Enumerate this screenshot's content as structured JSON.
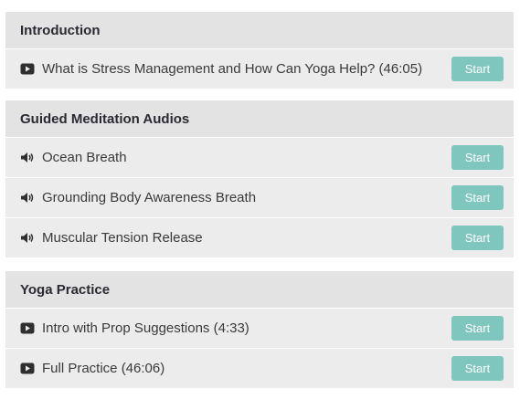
{
  "sections": [
    {
      "title": "Introduction",
      "lessons": [
        {
          "icon": "video-icon",
          "title": "What is Stress Management and How Can Yoga Help? (46:05)",
          "button": "Start"
        }
      ]
    },
    {
      "title": "Guided Meditation Audios",
      "lessons": [
        {
          "icon": "audio-icon",
          "title": "Ocean Breath",
          "button": "Start"
        },
        {
          "icon": "audio-icon",
          "title": "Grounding Body Awareness Breath",
          "button": "Start"
        },
        {
          "icon": "audio-icon",
          "title": "Muscular Tension Release",
          "button": "Start"
        }
      ]
    },
    {
      "title": "Yoga Practice",
      "lessons": [
        {
          "icon": "video-icon",
          "title": "Intro with Prop Suggestions (4:33)",
          "button": "Start"
        },
        {
          "icon": "video-icon",
          "title": "Full Practice (46:06)",
          "button": "Start"
        }
      ]
    }
  ],
  "colors": {
    "button": "#7fc7be",
    "header_bg": "#e3e3e3",
    "row_bg": "#ececec"
  }
}
